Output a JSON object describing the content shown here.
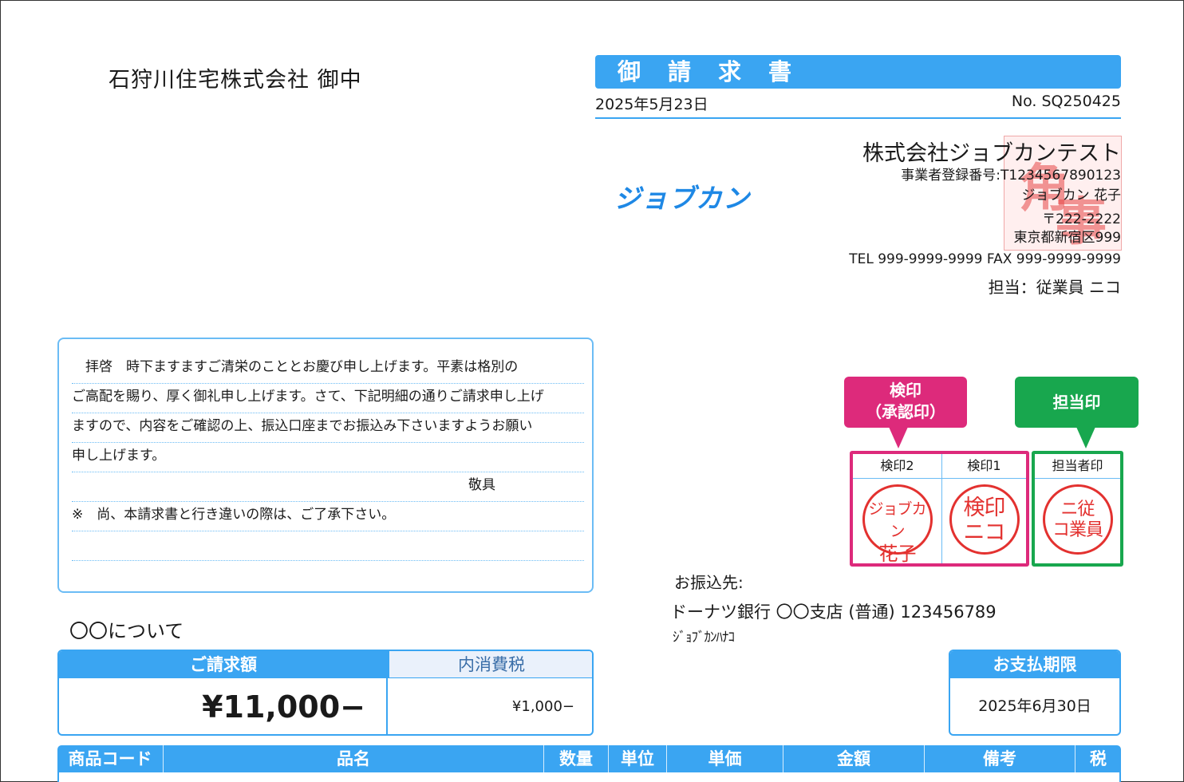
{
  "addressee": "石狩川住宅株式会社 御中",
  "document": {
    "title": "御請求書",
    "date": "2025年5月23日",
    "number": "No. SQ250425"
  },
  "logo_text": "ジョブカン",
  "issuer": {
    "company": "株式会社ジョブカンテスト",
    "registration": "事業者登録番号:T1234567890123",
    "person": "ジョブカン 花子",
    "zip": "〒222-2222",
    "address": "東京都新宿区999",
    "tel_fax": "TEL 999-9999-9999 FAX 999-9999-9999",
    "staff": "担当：従業員 ニコ"
  },
  "greeting": {
    "lines": [
      "　拝啓　時下ますますご清栄のこととお慶び申し上げます。平素は格別の",
      "ご高配を賜り、厚く御礼申し上げます。さて、下記明細の通りご請求申し上げ",
      "ますので、内容をご確認の上、振込口座までお振込み下さいますようお願い",
      "申し上げます。",
      "敬具",
      "※　尚、本請求書と行き違いの際は、ご了承下さい。",
      ""
    ]
  },
  "stamps": {
    "callout_approval": "検印\n（承認印）",
    "callout_approval_l1": "検印",
    "callout_approval_l2": "（承認印）",
    "callout_staff": "担当印",
    "cells": [
      {
        "label": "検印2",
        "seal_l1": "ジョブカン",
        "seal_l2": "花子"
      },
      {
        "label": "検印1",
        "seal_l1": "検印",
        "seal_l2": "ニコ"
      },
      {
        "label": "担当者印",
        "seal_l1": "ニ従",
        "seal_l2": "コ業員"
      }
    ]
  },
  "bank": {
    "label": "お振込先:",
    "account": "ドーナツ銀行 〇〇支店 (普通) 123456789",
    "holder_kana": "ｼﾞｮﾌﾞｶﾝﾊﾅｺ"
  },
  "subject": "〇〇について",
  "amount": {
    "total_label": "ご請求額",
    "total_value": "¥11,000−",
    "tax_label": "内消費税",
    "tax_value": "¥1,000−"
  },
  "due": {
    "label": "お支払期限",
    "value": "2025年6月30日"
  },
  "items_table": {
    "headers": [
      "商品コード",
      "品名",
      "数量",
      "単位",
      "単価",
      "金額",
      "備考",
      "税"
    ]
  },
  "colors": {
    "accent_blue": "#3aa5f2",
    "approval_pink": "#dd2a7b",
    "staff_green": "#18a74e",
    "seal_red": "#e3312f"
  }
}
